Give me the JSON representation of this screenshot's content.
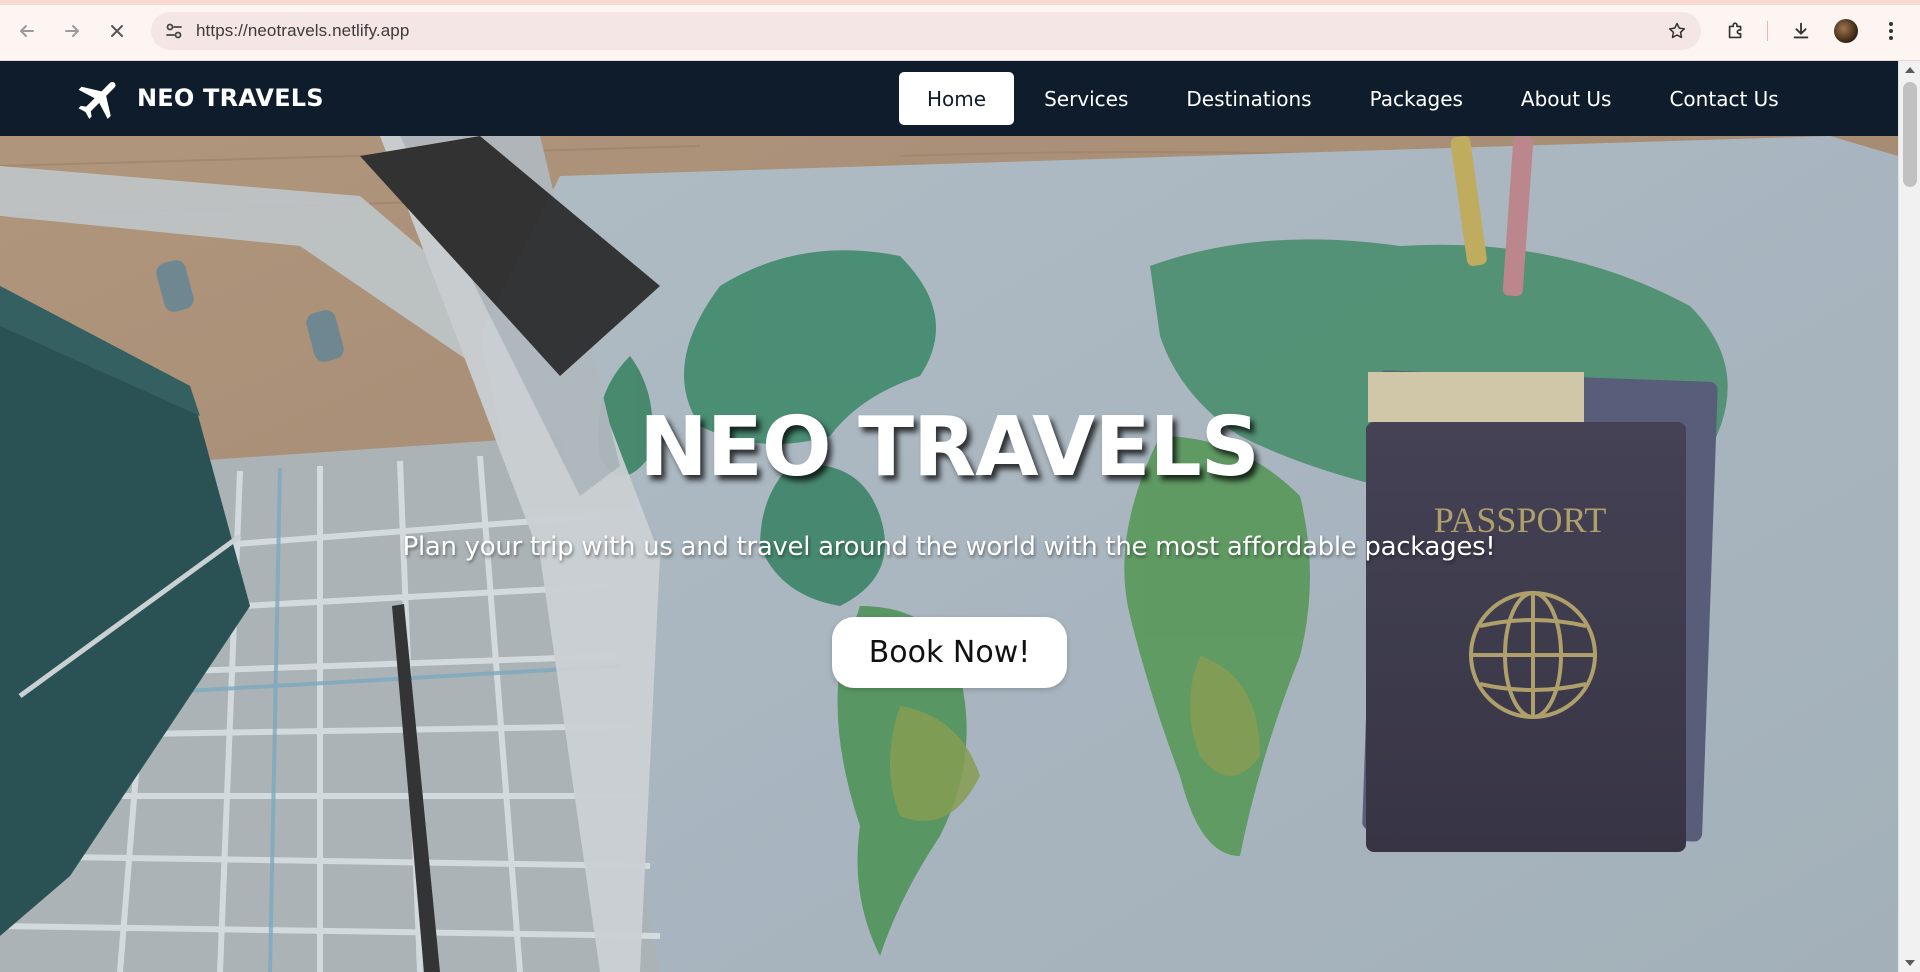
{
  "browser": {
    "url": "https://neotravels.netlify.app",
    "back_icon": "arrow-left-icon",
    "forward_icon": "arrow-right-icon",
    "stop_icon": "close-icon",
    "site_info_icon": "tune-icon",
    "bookmark_icon": "star-icon",
    "extensions_icon": "puzzle-icon",
    "downloads_icon": "download-icon",
    "menu_icon": "more-vertical-icon",
    "accent_color": "#f8d8cc"
  },
  "site": {
    "logo_icon": "airplane-icon",
    "logo_text": "NEO TRAVELS",
    "nav_background": "#0e1c2c",
    "nav": [
      {
        "label": "Home",
        "active": true
      },
      {
        "label": "Services",
        "active": false
      },
      {
        "label": "Destinations",
        "active": false
      },
      {
        "label": "Packages",
        "active": false
      },
      {
        "label": "About Us",
        "active": false
      },
      {
        "label": "Contact Us",
        "active": false
      }
    ]
  },
  "hero": {
    "title": "NEO TRAVELS",
    "subtitle": "Plan your trip with us and travel around the world with the most affordable packages!",
    "cta_label": "Book Now!",
    "passport_text": "PASSPORT"
  }
}
